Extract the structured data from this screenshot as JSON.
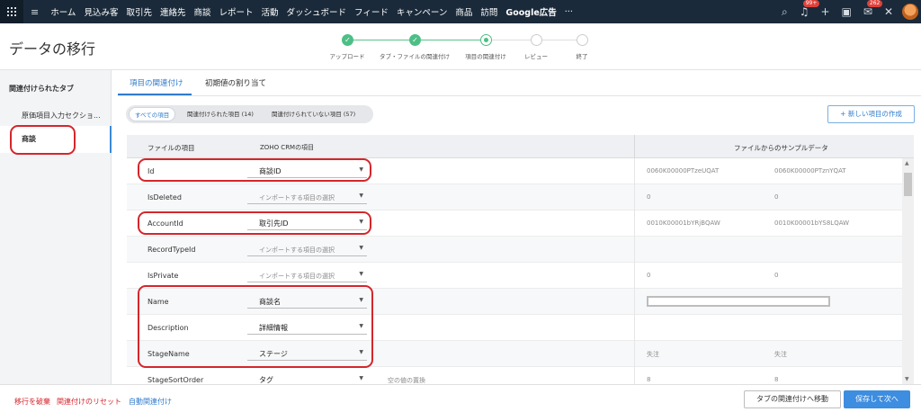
{
  "nav": {
    "items": [
      "ホーム",
      "見込み客",
      "取引先",
      "連絡先",
      "商談",
      "レポート",
      "活動",
      "ダッシュボード",
      "フィード",
      "キャンペーン",
      "商品",
      "訪問",
      "Google広告",
      "···"
    ],
    "notification_badge": "99+",
    "mail_badge": "262"
  },
  "header": {
    "title": "データの移行",
    "steps": [
      "アップロード",
      "タブ・ファイルの関連付け",
      "項目の関連付け",
      "レビュー",
      "終了"
    ],
    "current_step": 3
  },
  "sidebar": {
    "heading": "関連付けられたタブ",
    "items": [
      "原価項目入力セクショ...",
      "商談"
    ]
  },
  "tabs": [
    "項目の関連付け",
    "初期値の割り当て"
  ],
  "filters": [
    "すべての項目",
    "関連付けられた項目 (14)",
    "関連付けられていない項目 (57)"
  ],
  "new_field_button": "+ 新しい項目の作成",
  "table": {
    "headers": [
      "ファイルの項目",
      "ZOHO CRMの項目",
      "ファイルからのサンプルデータ"
    ],
    "rows": [
      {
        "field": "Id",
        "crm": "商談ID",
        "note": "",
        "s1": "0060K00000PTzeUQAT",
        "s2": "0060K00000PTznYQAT"
      },
      {
        "field": "IsDeleted",
        "crm": "インポートする項目の選択",
        "note": "",
        "s1": "0",
        "s2": "0"
      },
      {
        "field": "AccountId",
        "crm": "取引先ID",
        "note": "",
        "s1": "0010K00001bYRjBQAW",
        "s2": "0010K00001bYS8LQAW"
      },
      {
        "field": "RecordTypeId",
        "crm": "インポートする項目の選択",
        "note": "",
        "s1": "",
        "s2": ""
      },
      {
        "field": "IsPrivate",
        "crm": "インポートする項目の選択",
        "note": "",
        "s1": "0",
        "s2": "0"
      },
      {
        "field": "Name",
        "crm": "商談名",
        "note": "",
        "s1": "",
        "s2": ""
      },
      {
        "field": "Description",
        "crm": "詳細情報",
        "note": "",
        "s1": "",
        "s2": ""
      },
      {
        "field": "StageName",
        "crm": "ステージ",
        "note": "",
        "s1": "失注",
        "s2": "失注"
      },
      {
        "field": "StageSortOrder",
        "crm": "タグ",
        "note": "空の値の置換",
        "s1": "8",
        "s2": "8"
      }
    ]
  },
  "footer": {
    "discard": "移行を破棄",
    "reset": "関連付けのリセット",
    "auto": "自動関連付け",
    "move_button": "タブの関連付けへ移動",
    "save_button": "保存して次へ"
  },
  "colors": {
    "nav_bg": "#1b2a3a",
    "accent": "#2f7bcc",
    "step_done": "#4cbf86",
    "annotation_red": "#d4262c",
    "save_button": "#3d8de0"
  }
}
